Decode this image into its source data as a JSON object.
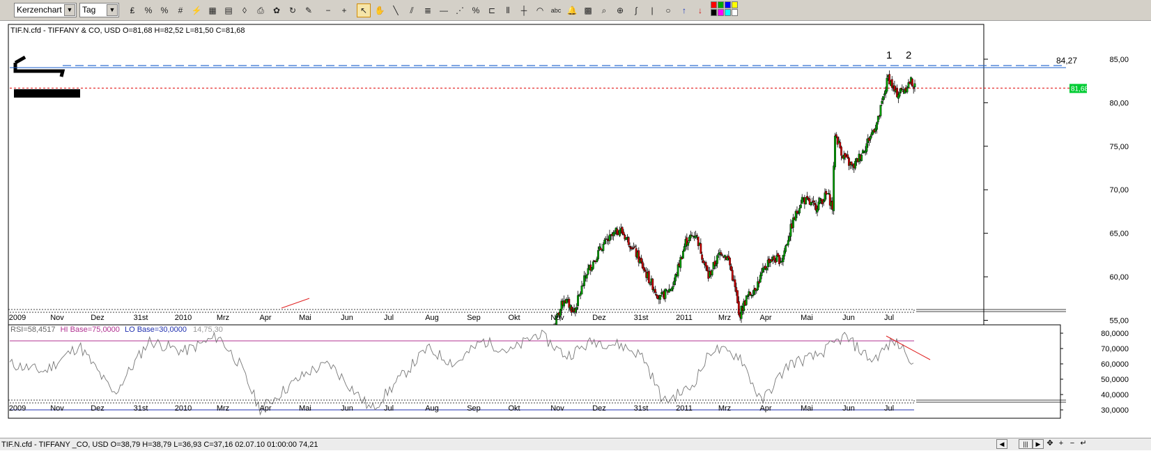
{
  "toolbar": {
    "chart_type": "Kerzenchart",
    "period": "Tag",
    "tools": [
      "chart-type-icon",
      "scale-icon",
      "scale2-icon",
      "grid-icon",
      "indicator-icon",
      "table-icon",
      "color-icon",
      "eraser-icon",
      "print-icon",
      "palette-icon",
      "refresh-icon",
      "template-icon",
      "zoom-out-button",
      "zoom-in-button",
      "cursor-tool",
      "hand-tool",
      "line-tool",
      "parallel-tool",
      "fibonacci-tool",
      "horizontal-line-tool",
      "fan-tool",
      "percent-tool",
      "bracket-tool",
      "cycle-tool",
      "vertical-line-tool",
      "arc-tool",
      "text-tool",
      "alarm-tool",
      "calculator-tool",
      "search-icon",
      "zoom-icon",
      "wave-tool",
      "divider",
      "circle-tool",
      "buy-arrow-tool",
      "sell-arrow-tool",
      "color-grid"
    ],
    "text_tool_label": "abc",
    "color_grid": [
      "#ff0000",
      "#00aa00",
      "#0000ff",
      "#ffff00",
      "#000000",
      "#ff00ff",
      "#00ffff",
      "#ffffff"
    ]
  },
  "main_panel": {
    "header": "TIF.N.cfd - TIFFANY & CO, USD O=81,68 H=82,52 L=81,50 C=81,68",
    "resistance_label": "84,27",
    "last_price_label": "81,68",
    "peak_labels": [
      "1",
      "2"
    ],
    "colors": {
      "up": "#00a000",
      "down": "#cc0000",
      "resistance": "#1a5fcc",
      "last_price": "#e00000"
    }
  },
  "rsi_panel": {
    "header_rsi": "RSI=58,4517",
    "header_hi": "HI Base=75,0000",
    "header_lo": "LO Base=30,0000",
    "header_params": "14,75,30",
    "colors": {
      "hi": "#b03090",
      "lo": "#2030b0",
      "line": "#777777",
      "trend": "#e02020"
    }
  },
  "status_bar": {
    "text": "TIF.N.cfd - TIFFANY _CO, USD O=38,79 H=38,79 L=36,93 C=37,16   02.07.10 01:00:00 74,21"
  },
  "chart_data": [
    {
      "type": "candlestick",
      "title": "TIF.N.cfd - TIFFANY & CO, USD O=81,68 H=82,52 L=81,50 C=81,68",
      "x_axis_labels": [
        "2009",
        "Nov",
        "Dez",
        "31st",
        "2010",
        "Mrz",
        "Apr",
        "Mai",
        "Jun",
        "Jul",
        "Aug",
        "Sep",
        "Okt",
        "Nov",
        "Dez",
        "31st",
        "2011",
        "Mrz",
        "Apr",
        "Mai",
        "Jun",
        "Jul"
      ],
      "y_ticks": [
        55,
        60,
        65,
        70,
        75,
        80,
        85
      ],
      "ylim": [
        54,
        89
      ],
      "resistance": 84.27,
      "last_close": 81.68,
      "waypoints": [
        [
          0,
          54.3
        ],
        [
          8,
          57.5
        ],
        [
          16,
          56
        ],
        [
          26,
          60.5
        ],
        [
          38,
          63.5
        ],
        [
          52,
          65.5
        ],
        [
          62,
          63.5
        ],
        [
          74,
          60
        ],
        [
          84,
          57.5
        ],
        [
          94,
          59
        ],
        [
          104,
          64
        ],
        [
          112,
          65
        ],
        [
          122,
          60
        ],
        [
          132,
          63
        ],
        [
          138,
          62
        ],
        [
          144,
          58
        ],
        [
          146,
          55.5
        ],
        [
          152,
          57.5
        ],
        [
          160,
          59
        ],
        [
          170,
          62
        ],
        [
          180,
          62
        ],
        [
          188,
          66
        ],
        [
          196,
          69
        ],
        [
          206,
          68
        ],
        [
          216,
          69.5
        ],
        [
          220,
          68
        ],
        [
          222,
          76.5
        ],
        [
          228,
          74
        ],
        [
          236,
          72.5
        ],
        [
          246,
          75
        ],
        [
          256,
          78
        ],
        [
          264,
          83
        ],
        [
          270,
          81
        ],
        [
          276,
          81.5
        ],
        [
          282,
          82.5
        ],
        [
          285,
          81.7
        ]
      ]
    },
    {
      "type": "line",
      "title": "RSI=58,4517 HI Base=75,0000 LO Base=30,0000 14,75,30",
      "y_ticks": [
        30,
        40,
        50,
        60,
        70,
        80
      ],
      "ylim": [
        25,
        85
      ],
      "hi_base": 75,
      "lo_base": 30,
      "last": 58.4517,
      "waypoints": [
        [
          0,
          60
        ],
        [
          50,
          55
        ],
        [
          100,
          72
        ],
        [
          150,
          40
        ],
        [
          200,
          75
        ],
        [
          250,
          68
        ],
        [
          300,
          78
        ],
        [
          330,
          60
        ],
        [
          360,
          30
        ],
        [
          400,
          45
        ],
        [
          430,
          55
        ],
        [
          460,
          60
        ],
        [
          490,
          45
        ],
        [
          520,
          30
        ],
        [
          560,
          50
        ],
        [
          600,
          70
        ],
        [
          640,
          60
        ],
        [
          680,
          75
        ],
        [
          720,
          68
        ],
        [
          760,
          80
        ],
        [
          800,
          65
        ],
        [
          840,
          75
        ],
        [
          880,
          72
        ],
        [
          910,
          65
        ],
        [
          940,
          35
        ],
        [
          980,
          45
        ],
        [
          1010,
          70
        ],
        [
          1050,
          65
        ],
        [
          1080,
          35
        ],
        [
          1120,
          60
        ],
        [
          1160,
          65
        ],
        [
          1200,
          78
        ],
        [
          1240,
          62
        ],
        [
          1270,
          75
        ],
        [
          1290,
          68
        ],
        [
          1300,
          58
        ]
      ]
    }
  ]
}
